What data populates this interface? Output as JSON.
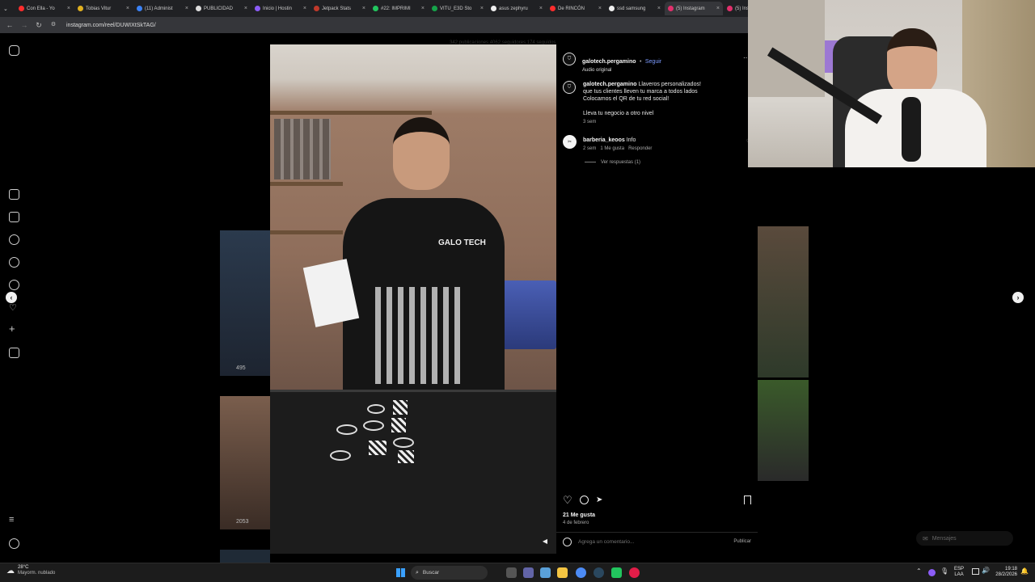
{
  "browser": {
    "tabs": [
      {
        "label": "Con Ella - Yo",
        "color": "#ff2d2d"
      },
      {
        "label": "Tobias Vitur",
        "color": "#e0b020"
      },
      {
        "label": "(11) Administ",
        "color": "#3b82f6"
      },
      {
        "label": "PUBLICIDAD",
        "color": "#dddddd"
      },
      {
        "label": "Inicio | Hostin",
        "color": "#8b5cf6"
      },
      {
        "label": "Jetpack Stats",
        "color": "#c0392b"
      },
      {
        "label": "#22: IMPRIMI",
        "color": "#22c55e"
      },
      {
        "label": "VITU_E3D Sto",
        "color": "#16a34a"
      },
      {
        "label": "asus zephyru",
        "color": "#eeeeee"
      },
      {
        "label": "De RINCÓN",
        "color": "#ff2d2d"
      },
      {
        "label": "ssd samsung",
        "color": "#eeeeee"
      },
      {
        "label": "(5) Instagram",
        "color": "#e1306c"
      },
      {
        "label": "(5) Instag",
        "color": "#e1306c"
      }
    ],
    "url": "instagram.com/reel/DUWIXtSkTAG/"
  },
  "post": {
    "username": "galotech.pergamino",
    "follow_label": "Seguir",
    "separator": "•",
    "audio": "Audio original",
    "caption_user": "galotech.pergamino",
    "caption_line1": "Llaveros personalizados!",
    "caption_line2": "que tus clientes lleven tu marca a todos lados",
    "caption_line3": "Colocamos el QR de tu red social!",
    "caption_line4": "Lleva tu negocio a otro nivel",
    "caption_time": "3 sem",
    "comment": {
      "user": "barberia_keoos",
      "text": "Info",
      "time": "2 sem",
      "likes": "1 Me gusta",
      "reply": "Responder",
      "view_replies": "Ver respuestas (1)"
    },
    "likes": "21 Me gusta",
    "date": "4 de febrero",
    "comment_placeholder": "Agrega un comentario...",
    "publish_label": "Publicar",
    "faded_header": "342 publicaciones   4062 seguidores   174 seguidos"
  },
  "bg_thumbs": {
    "views_1": "495",
    "views_2": "2053"
  },
  "messages_label": "Mensajes",
  "taskbar": {
    "weather_temp": "28°C",
    "weather_desc": "Mayorm. nublado",
    "search_label": "Buscar",
    "lang_1": "ESP",
    "lang_2": "LAA",
    "time": "19:18",
    "date": "28/2/2026"
  },
  "colors": {
    "accent": "#7c9bff",
    "like_red": "#ff3040"
  }
}
